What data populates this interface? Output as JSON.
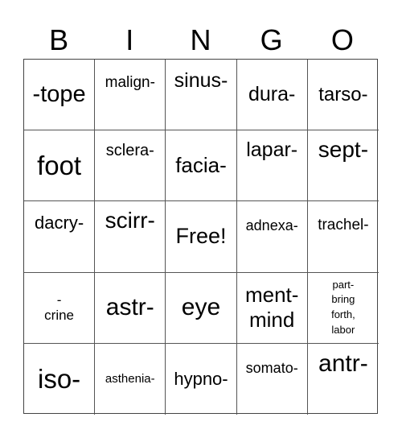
{
  "header": {
    "letters": [
      "B",
      "I",
      "N",
      "G",
      "O"
    ]
  },
  "cells": [
    [
      "-tope",
      "malign-",
      "sinus-",
      "dura-",
      "tarso-"
    ],
    [
      "foot",
      "sclera-",
      "facia-",
      "lapar-",
      "sept-"
    ],
    [
      "dacry-",
      "scirr-",
      "Free!",
      "adnexa-",
      "trachel-"
    ],
    [
      "-\ncrine",
      "astr-",
      "eye",
      "ment-\nmind",
      "part-\nbring\nforth,\nlabor"
    ],
    [
      "iso-",
      "asthenia-",
      "hypno-",
      "somato-",
      "antr-"
    ]
  ]
}
